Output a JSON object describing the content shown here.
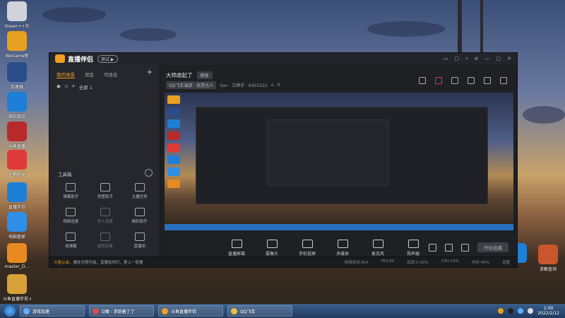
{
  "desktop": {
    "icons_left": [
      {
        "label": "Steam++社",
        "color": "#d0d4da"
      },
      {
        "label": "WeGame新",
        "color": "#e8a020"
      },
      {
        "label": "加速器",
        "color": "#2a4d8a"
      },
      {
        "label": "微软商店",
        "color": "#1e7fd6"
      },
      {
        "label": "斗鱼直播",
        "color": "#b82a2a"
      },
      {
        "label": "企鹅电竞",
        "color": "#e03a3a"
      },
      {
        "label": "直播伴侣",
        "color": "#1e7fd6"
      },
      {
        "label": "电脑管家",
        "color": "#2f8ee8"
      },
      {
        "label": "master_D...",
        "color": "#e88a20"
      },
      {
        "label": "斗鱼直播伴侣 6453322",
        "color": "#d8a23a"
      }
    ],
    "icons_right": [
      {
        "label": "",
        "color": "#1e7fd6"
      },
      {
        "label": "求都查询",
        "color": "#c9562e"
      }
    ]
  },
  "app": {
    "name": "直播伴侣",
    "version_badge": "测试 ▶",
    "tabs": [
      "我的场景",
      "双会",
      "可改名"
    ],
    "scene_item": "全屏 1",
    "tools_title": "工具箱",
    "tools": [
      {
        "label": "弹幕助手",
        "dim": false
      },
      {
        "label": "房管助手",
        "dim": false
      },
      {
        "label": "主播任务",
        "dim": false
      },
      {
        "label": "视频连麦",
        "dim": false
      },
      {
        "label": "多人连麦",
        "dim": true
      },
      {
        "label": "精彩助手",
        "dim": false
      },
      {
        "label": "收弹幕",
        "dim": false
      },
      {
        "label": "虚拟形象",
        "dim": true
      },
      {
        "label": "直播间",
        "dim": false
      },
      {
        "label": "",
        "dim": false
      },
      {
        "label": "",
        "dim": false
      },
      {
        "label": "",
        "dim": false
      }
    ],
    "room_title": "大师虐起了",
    "edit_label": "修改",
    "category": "QQ飞车端游 · 我是达人",
    "room_meta": "San · 王牌手 · 6453322",
    "fans": "0",
    "controls": [
      "直播屏幕",
      "摄像头",
      "手机投屏",
      "多媒体",
      "麦克风",
      "扬声器"
    ],
    "start_label": "开始直播",
    "notice_prefix": "斗鱼公会",
    "notice_text": "，播你无限可能，直播有你们，更上一层楼",
    "stats": [
      "网络状态:N/A",
      "FPS:60",
      "码率:0.00%",
      "CPU:19%",
      "内存:40%",
      "设置"
    ]
  },
  "taskbar": {
    "tasks": [
      {
        "label": "游戏加速",
        "color": "#5fb0ff"
      },
      {
        "label": "D魔 - 求助着了了",
        "color": "#d05050"
      },
      {
        "label": "斗鱼直播伴侣",
        "color": "#f0a020"
      },
      {
        "label": "QQ飞车",
        "color": "#e8c040"
      }
    ],
    "time": "1:00",
    "date": "2022/2/12"
  }
}
